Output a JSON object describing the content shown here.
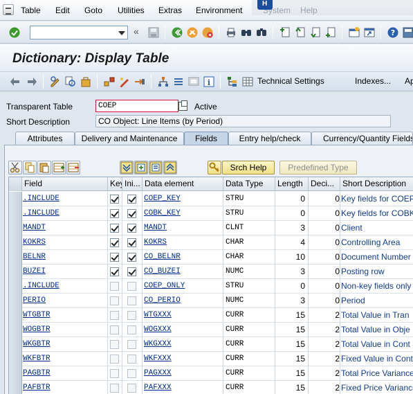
{
  "menu": {
    "items": [
      "Table",
      "Edit",
      "Goto",
      "Utilities",
      "Extras",
      "Environment"
    ],
    "overlay": [
      "System",
      "Help"
    ]
  },
  "toolbar": {
    "command_value": ""
  },
  "title": "Dictionary: Display Table",
  "app_toolbar": {
    "technical_settings": "Technical Settings",
    "indexes": "Indexes...",
    "append": "Ap"
  },
  "header": {
    "type_label": "Transparent Table",
    "table_name": "COEP",
    "status": "Active",
    "short_desc_label": "Short Description",
    "short_desc": "CO Object: Line Items (by Period)"
  },
  "tabs": [
    {
      "label": "Attributes"
    },
    {
      "label": "Delivery and Maintenance"
    },
    {
      "label": "Fields"
    },
    {
      "label": "Entry help/check"
    },
    {
      "label": "Currency/Quantity Fields"
    }
  ],
  "table_toolbar": {
    "srch_help": "Srch Help",
    "predefined_type": "Predefined Type"
  },
  "grid": {
    "columns": [
      "Field",
      "Key",
      "Ini...",
      "Data element",
      "Data Type",
      "Length",
      "Deci...",
      "Short Description"
    ],
    "rows": [
      {
        "field": ".INCLUDE",
        "key": true,
        "init": true,
        "key_enabled": true,
        "dataelement": "COEP_KEY",
        "datatype": "STRU",
        "length": "0",
        "decimals": "0",
        "desc": "Key fields for COEP"
      },
      {
        "field": ".INCLUDE",
        "key": true,
        "init": true,
        "key_enabled": true,
        "dataelement": "COBK_KEY",
        "datatype": "STRU",
        "length": "0",
        "decimals": "0",
        "desc": "Key fields for COBK"
      },
      {
        "field": "MANDT",
        "key": true,
        "init": true,
        "key_enabled": true,
        "dataelement": "MANDT",
        "datatype": "CLNT",
        "length": "3",
        "decimals": "0",
        "desc": "Client"
      },
      {
        "field": "KOKRS",
        "key": true,
        "init": true,
        "key_enabled": true,
        "dataelement": "KOKRS",
        "datatype": "CHAR",
        "length": "4",
        "decimals": "0",
        "desc": "Controlling Area"
      },
      {
        "field": "BELNR",
        "key": true,
        "init": true,
        "key_enabled": true,
        "dataelement": "CO_BELNR",
        "datatype": "CHAR",
        "length": "10",
        "decimals": "0",
        "desc": "Document Number"
      },
      {
        "field": "BUZEI",
        "key": true,
        "init": true,
        "key_enabled": true,
        "dataelement": "CO_BUZEI",
        "datatype": "NUMC",
        "length": "3",
        "decimals": "0",
        "desc": "Posting row"
      },
      {
        "field": ".INCLUDE",
        "key": false,
        "init": false,
        "key_enabled": false,
        "dataelement": "COEP_ONLY",
        "datatype": "STRU",
        "length": "0",
        "decimals": "0",
        "desc": "Non-key fields only"
      },
      {
        "field": "PERIO",
        "key": false,
        "init": false,
        "key_enabled": false,
        "dataelement": "CO_PERIO",
        "datatype": "NUMC",
        "length": "3",
        "decimals": "0",
        "desc": "Period"
      },
      {
        "field": "WTGBTR",
        "key": false,
        "init": false,
        "key_enabled": false,
        "dataelement": "WTGXXX",
        "datatype": "CURR",
        "length": "15",
        "decimals": "2",
        "desc": "Total Value in Tran"
      },
      {
        "field": "WOGBTR",
        "key": false,
        "init": false,
        "key_enabled": false,
        "dataelement": "WOGXXX",
        "datatype": "CURR",
        "length": "15",
        "decimals": "2",
        "desc": "Total Value in Obje"
      },
      {
        "field": "WKGBTR",
        "key": false,
        "init": false,
        "key_enabled": false,
        "dataelement": "WKGXXX",
        "datatype": "CURR",
        "length": "15",
        "decimals": "2",
        "desc": "Total Value in Cont"
      },
      {
        "field": "WKFBTR",
        "key": false,
        "init": false,
        "key_enabled": false,
        "dataelement": "WKFXXX",
        "datatype": "CURR",
        "length": "15",
        "decimals": "2",
        "desc": "Fixed Value in Cont"
      },
      {
        "field": "PAGBTR",
        "key": false,
        "init": false,
        "key_enabled": false,
        "dataelement": "PAGXXX",
        "datatype": "CURR",
        "length": "15",
        "decimals": "2",
        "desc": "Total Price Variance"
      },
      {
        "field": "PAFBTR",
        "key": false,
        "init": false,
        "key_enabled": false,
        "dataelement": "PAFXXX",
        "datatype": "CURR",
        "length": "15",
        "decimals": "2",
        "desc": "Fixed Price Variance"
      }
    ]
  },
  "colors": {
    "link": "#002c8a",
    "desc_text": "#123c8c",
    "focus_border": "#dd1144"
  }
}
